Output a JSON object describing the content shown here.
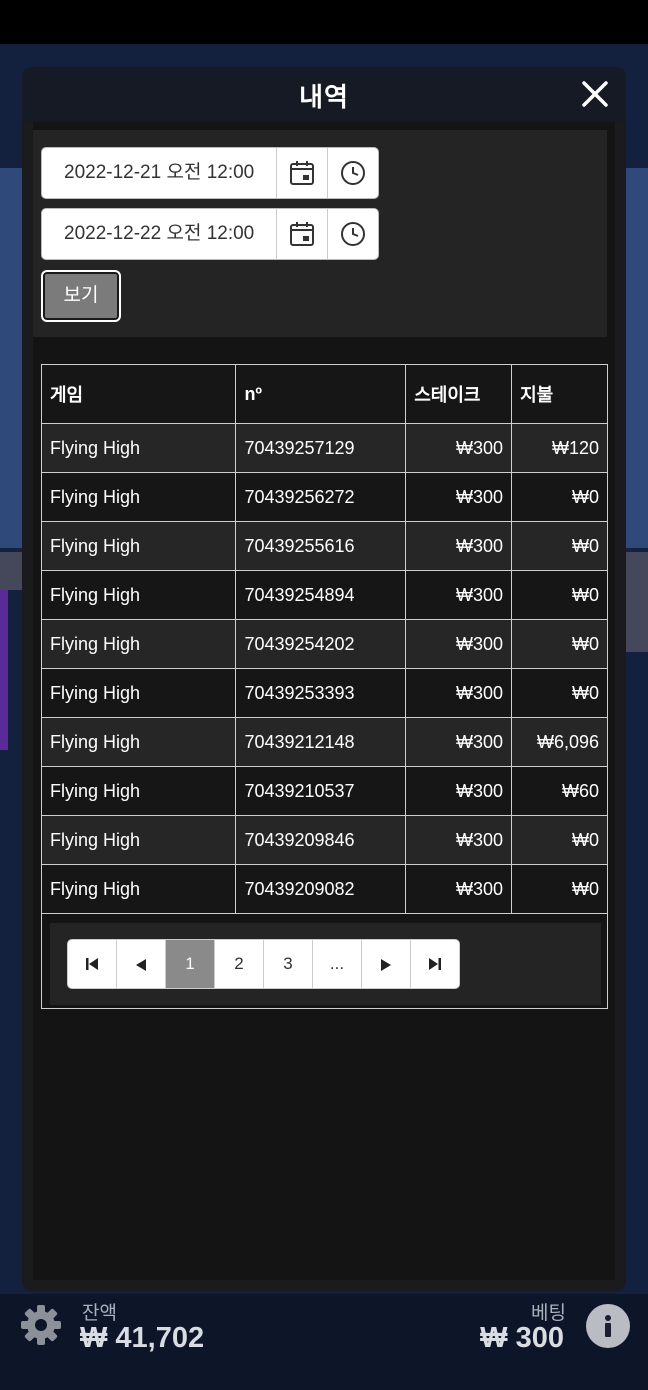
{
  "modal": {
    "title": "내역",
    "close_icon": "close-icon"
  },
  "filter": {
    "from_datetime": "2022-12-21 오전 12:00",
    "to_datetime": "2022-12-22 오전 12:00",
    "view_button": "보기",
    "calendar_icon": "calendar-icon",
    "clock_icon": "clock-icon"
  },
  "table": {
    "headers": [
      "게임",
      "nº",
      "스테이크",
      "지불"
    ],
    "rows": [
      [
        "Flying High",
        "70439257129",
        "₩300",
        "₩120"
      ],
      [
        "Flying High",
        "70439256272",
        "₩300",
        "₩0"
      ],
      [
        "Flying High",
        "70439255616",
        "₩300",
        "₩0"
      ],
      [
        "Flying High",
        "70439254894",
        "₩300",
        "₩0"
      ],
      [
        "Flying High",
        "70439254202",
        "₩300",
        "₩0"
      ],
      [
        "Flying High",
        "70439253393",
        "₩300",
        "₩0"
      ],
      [
        "Flying High",
        "70439212148",
        "₩300",
        "₩6,096"
      ],
      [
        "Flying High",
        "70439210537",
        "₩300",
        "₩60"
      ],
      [
        "Flying High",
        "70439209846",
        "₩300",
        "₩0"
      ],
      [
        "Flying High",
        "70439209082",
        "₩300",
        "₩0"
      ]
    ]
  },
  "pagination": {
    "pages": [
      "1",
      "2",
      "3",
      "..."
    ],
    "current": "1"
  },
  "footer": {
    "balance_label": "잔액",
    "balance_value": "₩ 41,702",
    "bet_label": "베팅",
    "bet_value": "₩ 300",
    "settings_icon": "gear-icon",
    "info_icon": "info-icon"
  },
  "colors": {
    "modal_bg": "#1b1b1d",
    "row_odd": "#262626",
    "row_even": "#161616",
    "active_page": "#8a8a8a"
  }
}
